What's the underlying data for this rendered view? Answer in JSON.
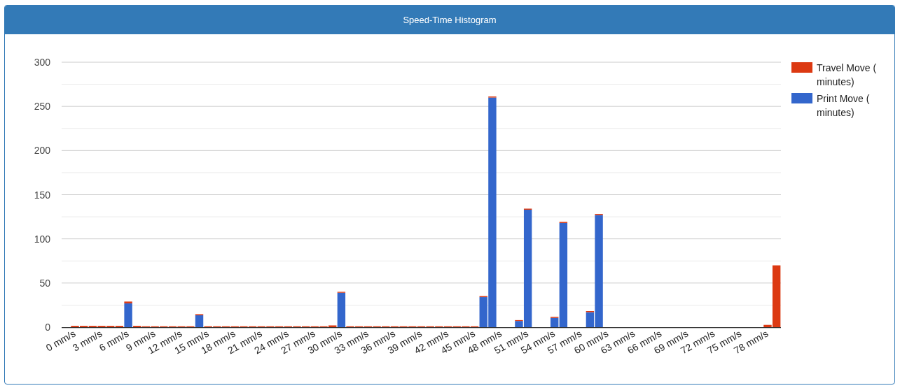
{
  "panel": {
    "title": "Speed-Time Histogram"
  },
  "chart_data": {
    "type": "bar",
    "stacked": true,
    "orientation": "vertical",
    "grid": true,
    "legend": "right",
    "x": [
      0,
      1,
      2,
      3,
      4,
      5,
      6,
      7,
      8,
      9,
      10,
      11,
      12,
      13,
      14,
      15,
      16,
      17,
      18,
      19,
      20,
      21,
      22,
      23,
      24,
      25,
      26,
      27,
      28,
      29,
      30,
      31,
      32,
      33,
      34,
      35,
      36,
      37,
      38,
      39,
      40,
      41,
      42,
      43,
      44,
      45,
      46,
      47,
      48,
      49,
      50,
      51,
      52,
      53,
      54,
      55,
      56,
      57,
      58,
      59,
      60,
      61,
      62,
      63,
      64,
      65,
      66,
      67,
      68,
      69,
      70,
      71,
      72,
      73,
      74,
      75,
      76,
      77,
      78,
      79
    ],
    "series": [
      {
        "name": "Print Move ( minutes)",
        "color": "#3366cc",
        "values": [
          0,
          0,
          0,
          0,
          0,
          0,
          27,
          0,
          0,
          0,
          0,
          0,
          0,
          0,
          13.5,
          0,
          0,
          0,
          0,
          0,
          0,
          0,
          0,
          0,
          0,
          0,
          0,
          0,
          0,
          0,
          39,
          0,
          0,
          0,
          0,
          0,
          0,
          0,
          0,
          0,
          0,
          0,
          0,
          0,
          0,
          0,
          34,
          260,
          0,
          0,
          7,
          133,
          0,
          0,
          10.5,
          118,
          0,
          0,
          17,
          127,
          0,
          0,
          0,
          0,
          0,
          0,
          0,
          0,
          0,
          0,
          0,
          0,
          0,
          0,
          0,
          0,
          0,
          0,
          0,
          0
        ]
      },
      {
        "name": "Travel Move ( minutes)",
        "color": "#dc3912",
        "values": [
          1.5,
          1.5,
          1.5,
          1.5,
          1.5,
          1.5,
          2,
          1.5,
          1,
          1,
          1,
          1,
          1,
          1,
          1.2,
          1,
          1,
          1,
          1,
          1,
          1,
          1,
          1,
          1,
          1,
          1,
          1,
          1,
          1,
          2,
          1,
          1,
          1,
          1,
          1,
          1,
          1,
          1,
          1,
          1,
          1,
          1,
          1,
          1,
          1,
          1,
          1.2,
          1.2,
          0,
          0,
          1,
          1.2,
          0,
          0,
          1.2,
          1.2,
          0,
          0,
          1.2,
          1.2,
          0,
          0,
          0,
          0,
          0,
          0,
          0,
          0,
          0,
          0,
          0,
          0,
          0,
          0,
          0,
          0,
          0,
          0,
          2.6,
          70
        ]
      }
    ],
    "xlim": [
      -1.5,
      79.5
    ],
    "ylim": [
      0,
      300
    ],
    "yticks": [
      0,
      50,
      100,
      150,
      200,
      250,
      300
    ],
    "xticks": [
      {
        "value": 0,
        "label": "0 mm/s"
      },
      {
        "value": 3,
        "label": "3 mm/s"
      },
      {
        "value": 6,
        "label": "6 mm/s"
      },
      {
        "value": 9,
        "label": "9 mm/s"
      },
      {
        "value": 12,
        "label": "12 mm/s"
      },
      {
        "value": 15,
        "label": "15 mm/s"
      },
      {
        "value": 18,
        "label": "18 mm/s"
      },
      {
        "value": 21,
        "label": "21 mm/s"
      },
      {
        "value": 24,
        "label": "24 mm/s"
      },
      {
        "value": 27,
        "label": "27 mm/s"
      },
      {
        "value": 30,
        "label": "30 mm/s"
      },
      {
        "value": 33,
        "label": "33 mm/s"
      },
      {
        "value": 36,
        "label": "36 mm/s"
      },
      {
        "value": 39,
        "label": "39 mm/s"
      },
      {
        "value": 42,
        "label": "42 mm/s"
      },
      {
        "value": 45,
        "label": "45 mm/s"
      },
      {
        "value": 48,
        "label": "48 mm/s"
      },
      {
        "value": 51,
        "label": "51 mm/s"
      },
      {
        "value": 54,
        "label": "54 mm/s"
      },
      {
        "value": 57,
        "label": "57 mm/s"
      },
      {
        "value": 60,
        "label": "60 mm/s"
      },
      {
        "value": 63,
        "label": "63 mm/s"
      },
      {
        "value": 66,
        "label": "66 mm/s"
      },
      {
        "value": 69,
        "label": "69 mm/s"
      },
      {
        "value": 72,
        "label": "72 mm/s"
      },
      {
        "value": 75,
        "label": "75 mm/s"
      },
      {
        "value": 78,
        "label": "78 mm/s"
      }
    ]
  }
}
